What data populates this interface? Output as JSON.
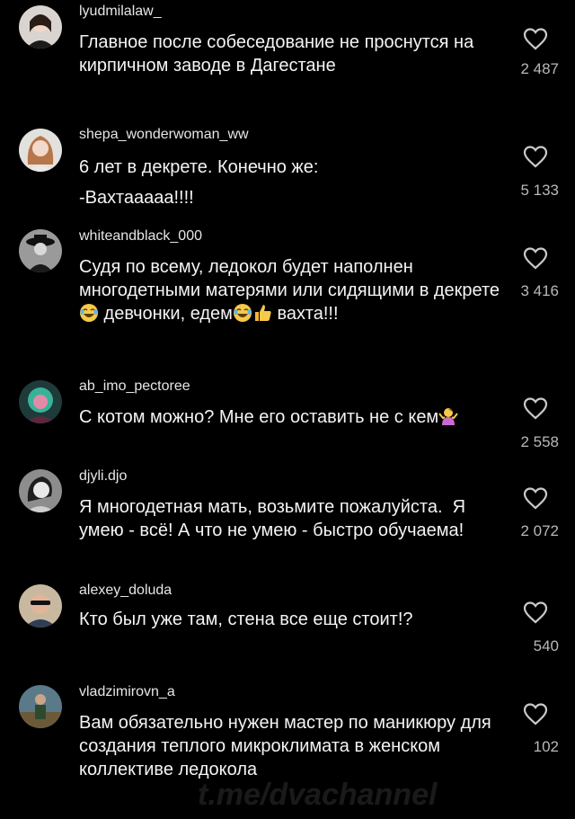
{
  "colors": {
    "background": "#000000",
    "text": "#f4f4f4",
    "username": "#e6e6e6",
    "likes": "#b8b8b8",
    "heart": "#c9c9c9"
  },
  "watermark": {
    "text": "t.me/dvachannel"
  },
  "comments": [
    {
      "username": "lyudmilalaw_",
      "text": "Главное после собеседование не проснутся на кирпичном заводе в Дагестане",
      "likes": "2 487"
    },
    {
      "username": "shepa_wonderwoman_ww",
      "text": "6 лет в декрете. Конечно же:\n-Вахтааааа!!!!",
      "likes": "5 133"
    },
    {
      "username": "whiteandblack_000",
      "text_parts": [
        "Судя по всему, ледокол будет наполнен многодетными матерями или сидящими в декрете",
        " девчонки, едем",
        "",
        " вахта!!!"
      ],
      "emojis": [
        "laughing-emoji",
        "laughing-emoji",
        "thumbs-up-emoji"
      ],
      "likes": "3 416"
    },
    {
      "username": "ab_imo_pectoree",
      "text_parts": [
        "С котом можно? Мне его оставить не с кем"
      ],
      "emojis": [
        "shrug-emoji"
      ],
      "likes": "2 558"
    },
    {
      "username": "djyli.djo",
      "text": "Я многодетная мать, возьмите пожалуйста.  Я умею - всё! А что не умею - быстро обучаема!",
      "likes": "2 072"
    },
    {
      "username": "alexey_doluda",
      "text": "Кто был уже там, стена все еще стоит!?",
      "likes": "540"
    },
    {
      "username": "vladzimirovn_a",
      "text": "Вам обязательно нужен мастер по маникюру для создания теплого микроклимата в женском коллективе ледокола",
      "likes": "102"
    }
  ]
}
